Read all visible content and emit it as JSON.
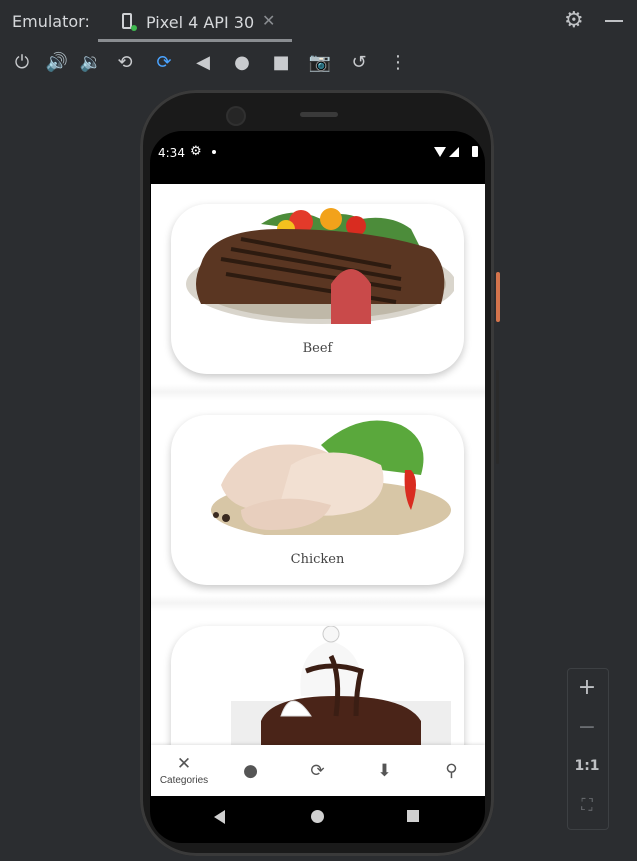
{
  "emulator": {
    "title": "Emulator:",
    "tab_label": "Pixel 4 API 30",
    "tab_close": "✕"
  },
  "toolbar": {
    "icons": [
      "power-icon",
      "volume-up-icon",
      "volume-down-icon",
      "rotate-left-icon",
      "rotate-right-icon",
      "back-icon",
      "home-icon",
      "overview-icon",
      "camera-icon",
      "snapshot-icon",
      "more-icon"
    ]
  },
  "status_bar": {
    "time": "4:34"
  },
  "categories": [
    {
      "label": "Beef"
    },
    {
      "label": "Chicken"
    },
    {
      "label": ""
    }
  ],
  "bottom_nav": {
    "items": [
      {
        "label": "Categories",
        "icon": "utensils-icon"
      },
      {
        "label": "",
        "icon": "cookie-icon"
      },
      {
        "label": "",
        "icon": "refresh-icon"
      },
      {
        "label": "",
        "icon": "location-pin-icon"
      },
      {
        "label": "",
        "icon": "search-icon"
      }
    ]
  },
  "zoom": {
    "plus": "+",
    "minus": "−",
    "one_to_one": "1:1"
  }
}
